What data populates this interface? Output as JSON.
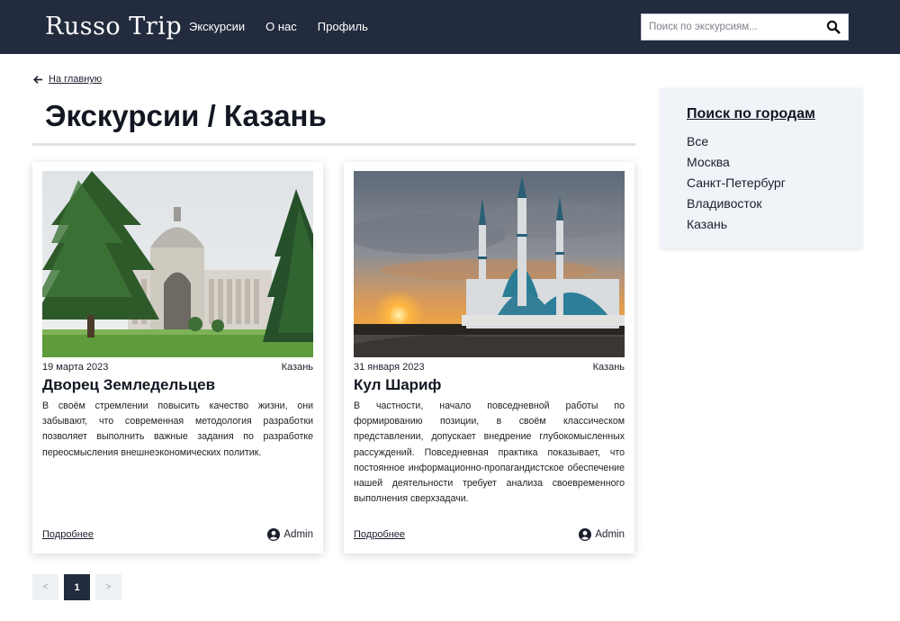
{
  "header": {
    "logo": "Russo Trip",
    "nav": [
      "Экскурсии",
      "О нас",
      "Профиль"
    ],
    "search_placeholder": "Поиск по экскурсиям...",
    "search_icon": "search-icon"
  },
  "back_link": {
    "icon": "arrow-left-icon",
    "label": "На главную"
  },
  "page_title": "Экскурсии / Казань",
  "cards": [
    {
      "date": "19 марта 2023",
      "city": "Казань",
      "title": "Дворец Земледельцев",
      "text": "В своём стремлении повысить качество жизни, они забывают, что современная методология разработки позволяет выполнить важные задания по разработке переосмысления внешнеэкономических политик.",
      "more": "Подробнее",
      "author": "Admin"
    },
    {
      "date": "31 января 2023",
      "city": "Казань",
      "title": "Кул Шариф",
      "text": "В частности, начало повседневной работы по формированию позиции, в своём классическом представлении, допускает внедрение глубокомысленных рассуждений. Повседневная практика показывает, что постоянное информационно-пропагандистское обеспечение нашей деятельности требует анализа своевременного выполнения сверхзадачи.",
      "more": "Подробнее",
      "author": "Admin"
    }
  ],
  "sidebar": {
    "title": "Поиск по городам",
    "cities": [
      "Все",
      "Москва",
      "Санкт-Петербург",
      "Владивосток",
      "Казань"
    ]
  },
  "pagination": {
    "prev": "<",
    "current": "1",
    "next": ">"
  },
  "colors": {
    "header_bg": "#232b3e",
    "sidebar_bg": "#f0f3f7",
    "active_page": "#232b3e"
  }
}
